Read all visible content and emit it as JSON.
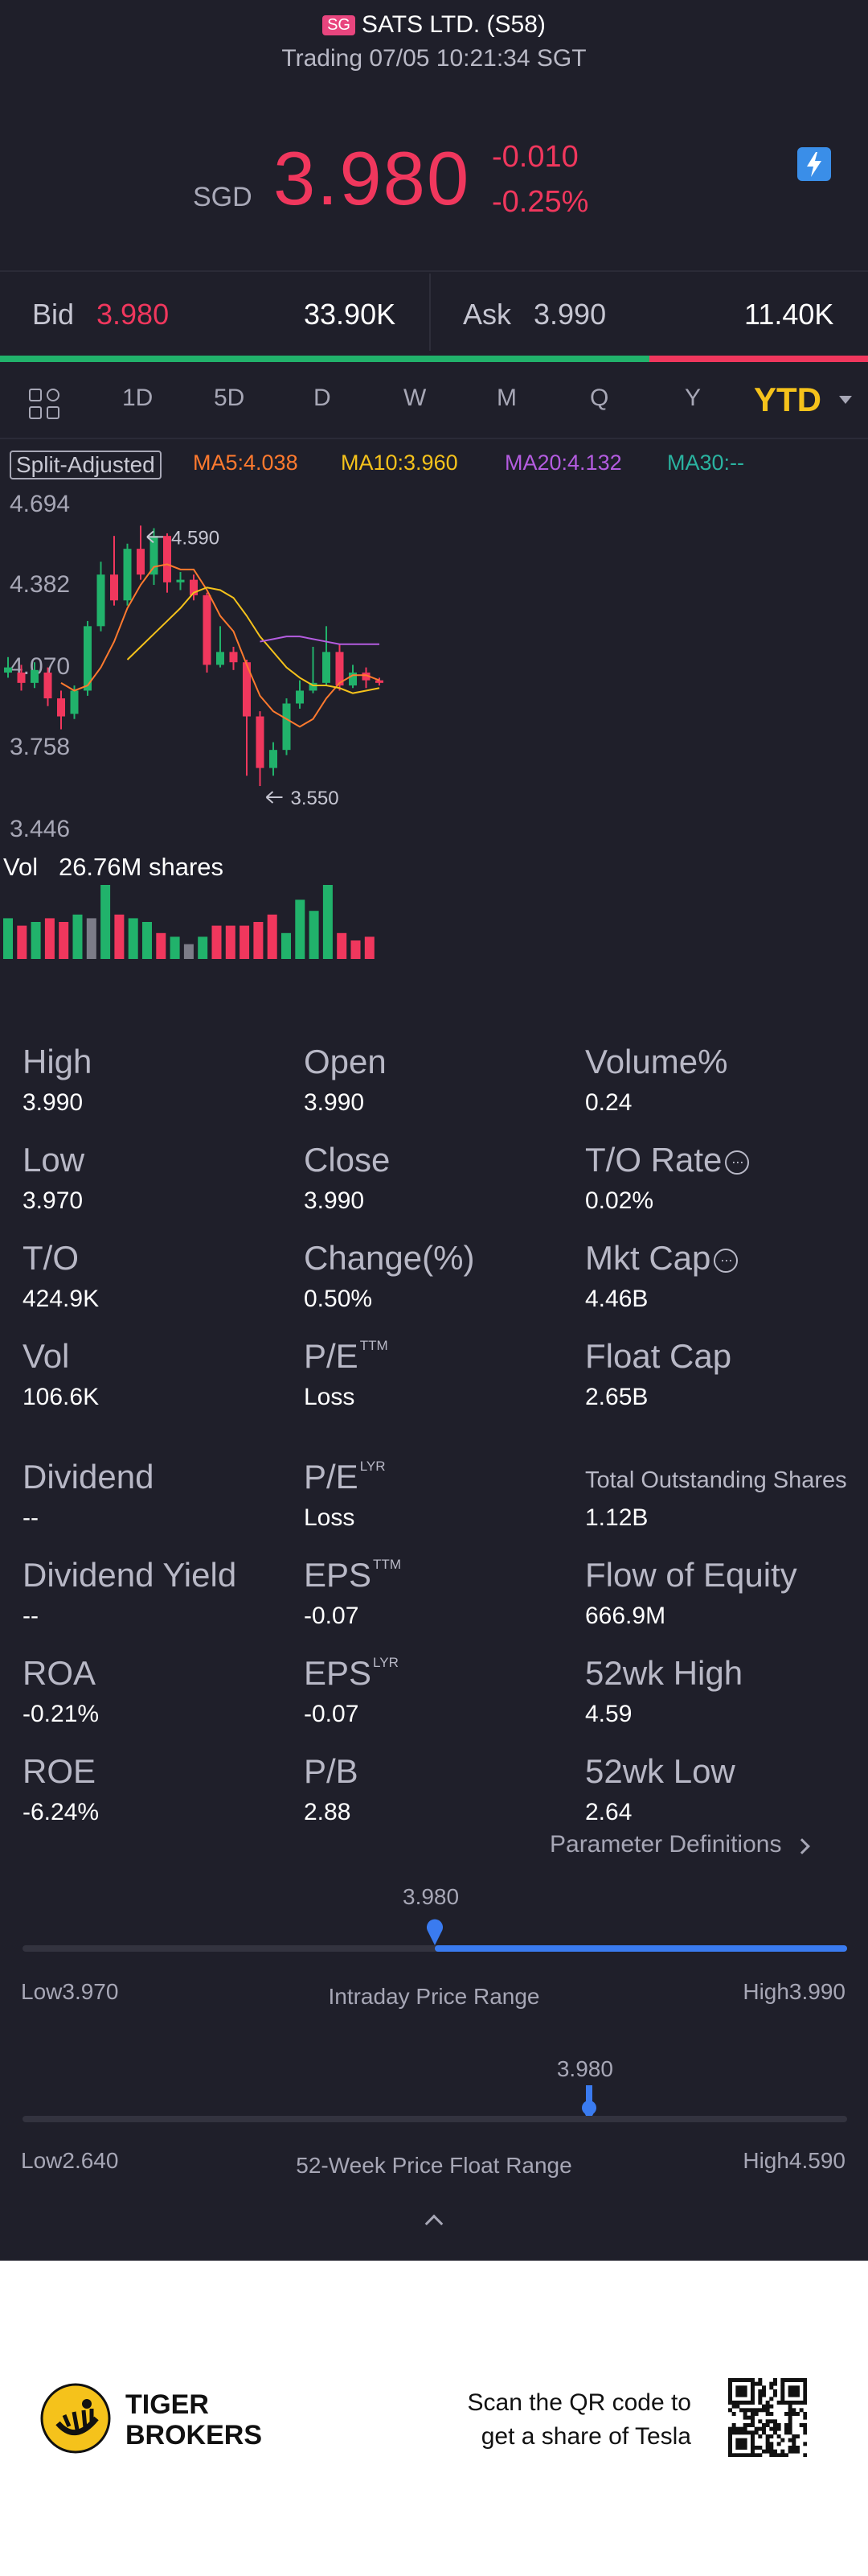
{
  "header": {
    "market_badge": "SG",
    "title": "SATS LTD. (S58)",
    "status": "Trading 07/05 10:21:34 SGT"
  },
  "quote": {
    "currency": "SGD",
    "price": "3.980",
    "change": "-0.010",
    "change_pct": "-0.25%",
    "color_down": "#f0375d",
    "color_up": "#21b26b"
  },
  "orderbook": {
    "bid_label": "Bid",
    "bid_price": "3.980",
    "bid_size": "33.90K",
    "ask_label": "Ask",
    "ask_price": "3.990",
    "ask_size": "11.40K",
    "bid_ratio": 0.748
  },
  "periods": {
    "icon": "grid-icon",
    "items": [
      "1D",
      "5D",
      "D",
      "W",
      "M",
      "Q",
      "Y"
    ],
    "active": "YTD",
    "dropdown_icon": "caret-down-icon"
  },
  "indicators": {
    "split": "Split-Adjusted",
    "ma5": "MA5:4.038",
    "ma10": "MA10:3.960",
    "ma20": "MA20:4.132",
    "ma30": "MA30:--"
  },
  "chart_data": {
    "type": "candlestick",
    "y_ticks": [
      "4.694",
      "4.382",
      "4.070",
      "3.758",
      "3.446"
    ],
    "ylim": [
      3.446,
      4.694
    ],
    "max_label": "4.590",
    "min_label": "3.550",
    "candles": [
      [
        4.04,
        4.02,
        4.08,
        4.0,
        "up"
      ],
      [
        4.02,
        3.98,
        4.05,
        3.95,
        "down"
      ],
      [
        3.98,
        4.03,
        4.06,
        3.96,
        "up"
      ],
      [
        4.02,
        3.92,
        4.04,
        3.89,
        "down"
      ],
      [
        3.92,
        3.85,
        3.95,
        3.8,
        "down"
      ],
      [
        3.86,
        3.95,
        3.97,
        3.84,
        "up"
      ],
      [
        3.95,
        4.2,
        4.22,
        3.93,
        "up"
      ],
      [
        4.2,
        4.4,
        4.45,
        4.18,
        "up"
      ],
      [
        4.4,
        4.3,
        4.55,
        4.28,
        "down"
      ],
      [
        4.3,
        4.5,
        4.52,
        4.28,
        "up"
      ],
      [
        4.5,
        4.4,
        4.59,
        4.38,
        "down"
      ],
      [
        4.4,
        4.55,
        4.58,
        4.36,
        "up"
      ],
      [
        4.55,
        4.37,
        4.56,
        4.33,
        "down"
      ],
      [
        4.37,
        4.38,
        4.41,
        4.34,
        "up"
      ],
      [
        4.38,
        4.32,
        4.4,
        4.3,
        "down"
      ],
      [
        4.32,
        4.05,
        4.33,
        4.02,
        "down"
      ],
      [
        4.05,
        4.1,
        4.2,
        4.04,
        "up"
      ],
      [
        4.1,
        4.06,
        4.12,
        4.03,
        "down"
      ],
      [
        4.06,
        3.85,
        4.07,
        3.62,
        "down"
      ],
      [
        3.85,
        3.65,
        3.87,
        3.58,
        "down"
      ],
      [
        3.65,
        3.72,
        3.75,
        3.62,
        "up"
      ],
      [
        3.72,
        3.9,
        3.92,
        3.7,
        "up"
      ],
      [
        3.9,
        3.95,
        3.99,
        3.88,
        "up"
      ],
      [
        3.95,
        3.98,
        4.12,
        3.94,
        "up"
      ],
      [
        3.98,
        4.1,
        4.2,
        3.97,
        "up"
      ],
      [
        4.1,
        3.97,
        4.13,
        3.95,
        "down"
      ],
      [
        3.97,
        4.02,
        4.05,
        3.96,
        "up"
      ],
      [
        4.02,
        3.99,
        4.04,
        3.96,
        "down"
      ],
      [
        3.99,
        3.98,
        4.0,
        3.97,
        "down"
      ]
    ],
    "ma_series": [
      {
        "name": "MA5",
        "color": "#ff7a2e",
        "values": [
          null,
          null,
          null,
          null,
          3.98,
          3.95,
          3.97,
          4.04,
          4.14,
          4.27,
          4.36,
          4.43,
          4.44,
          4.42,
          4.42,
          4.34,
          4.24,
          4.18,
          4.05,
          3.93,
          3.87,
          3.84,
          3.81,
          3.84,
          3.92,
          3.98,
          4.01,
          4.01,
          3.99
        ]
      },
      {
        "name": "MA10",
        "color": "#f5c21b",
        "values": [
          null,
          null,
          null,
          null,
          null,
          null,
          null,
          null,
          null,
          4.07,
          4.12,
          4.17,
          4.22,
          4.27,
          4.33,
          4.35,
          4.34,
          4.31,
          4.24,
          4.16,
          4.1,
          4.04,
          4.0,
          3.97,
          3.97,
          3.96,
          3.94,
          3.95,
          3.96
        ]
      },
      {
        "name": "MA20",
        "color": "#b45ce0",
        "values": [
          null,
          null,
          null,
          null,
          null,
          null,
          null,
          null,
          null,
          null,
          null,
          null,
          null,
          null,
          null,
          null,
          null,
          null,
          null,
          4.14,
          4.15,
          4.16,
          4.16,
          4.15,
          4.14,
          4.13,
          4.13,
          4.13,
          4.13
        ]
      }
    ],
    "volume_label": "Vol",
    "volume_value": "26.76M shares",
    "volume": [
      [
        0.55,
        "up"
      ],
      [
        0.45,
        "down"
      ],
      [
        0.5,
        "up"
      ],
      [
        0.55,
        "down"
      ],
      [
        0.5,
        "down"
      ],
      [
        0.6,
        "up"
      ],
      [
        0.55,
        "gray"
      ],
      [
        1.0,
        "up"
      ],
      [
        0.6,
        "down"
      ],
      [
        0.55,
        "up"
      ],
      [
        0.5,
        "up"
      ],
      [
        0.35,
        "down"
      ],
      [
        0.3,
        "up"
      ],
      [
        0.2,
        "gray"
      ],
      [
        0.3,
        "up"
      ],
      [
        0.45,
        "down"
      ],
      [
        0.45,
        "down"
      ],
      [
        0.45,
        "down"
      ],
      [
        0.5,
        "down"
      ],
      [
        0.6,
        "down"
      ],
      [
        0.35,
        "up"
      ],
      [
        0.8,
        "up"
      ],
      [
        0.65,
        "up"
      ],
      [
        1.0,
        "up"
      ],
      [
        0.35,
        "down"
      ],
      [
        0.25,
        "down"
      ],
      [
        0.3,
        "down"
      ]
    ]
  },
  "stats": {
    "c1": [
      {
        "label": "High",
        "value": "3.990"
      },
      {
        "label": "Low",
        "value": "3.970"
      },
      {
        "label": "T/O",
        "value": "424.9K"
      },
      {
        "label": "Vol",
        "value": "106.6K"
      },
      {
        "label": "Dividend",
        "value": "--"
      },
      {
        "label": "Dividend Yield",
        "value": "--"
      },
      {
        "label": "ROA",
        "value": "-0.21%"
      },
      {
        "label": "ROE",
        "value": "-6.24%"
      }
    ],
    "c2": [
      {
        "label": "Open",
        "value": "3.990"
      },
      {
        "label": "Close",
        "value": "3.990"
      },
      {
        "label": "Change(%)",
        "value": "0.50%"
      },
      {
        "label": "P/E",
        "sup": "TTM",
        "value": "Loss"
      },
      {
        "label": "P/E",
        "sup": "LYR",
        "value": "Loss"
      },
      {
        "label": "EPS",
        "sup": "TTM",
        "value": "-0.07"
      },
      {
        "label": "EPS",
        "sup": "LYR",
        "value": "-0.07"
      },
      {
        "label": "P/B",
        "value": "2.88"
      }
    ],
    "c3": [
      {
        "label": "Volume%",
        "value": "0.24"
      },
      {
        "label": "T/O Rate",
        "value": "0.02%"
      },
      {
        "label": "Mkt Cap",
        "value": "4.46B"
      },
      {
        "label": "Float Cap",
        "value": "2.65B"
      },
      {
        "label": "Total Outstanding Shares",
        "value": "1.12B"
      },
      {
        "label": "Flow of Equity",
        "value": "666.9M"
      },
      {
        "label": "52wk High",
        "value": "4.59"
      },
      {
        "label": "52wk Low",
        "value": "2.64"
      }
    ],
    "info_icon": "more-info-icon",
    "param_link": "Parameter Definitions"
  },
  "intraday": {
    "value": "3.980",
    "low": "Low3.970",
    "high": "High3.990",
    "title": "Intraday Price Range",
    "position": 0.5,
    "color": "#3a7bf0"
  },
  "week52": {
    "value": "3.980",
    "low": "Low2.640",
    "high": "High4.590",
    "title": "52-Week Price Float Range",
    "position": 0.687,
    "color": "#3a7bf0"
  },
  "footer": {
    "brand_line1": "TIGER",
    "brand_line2": "BROKERS",
    "cta_line1": "Scan the QR code to",
    "cta_line2": "get a share of Tesla",
    "brand_color": "#f5c21b"
  }
}
